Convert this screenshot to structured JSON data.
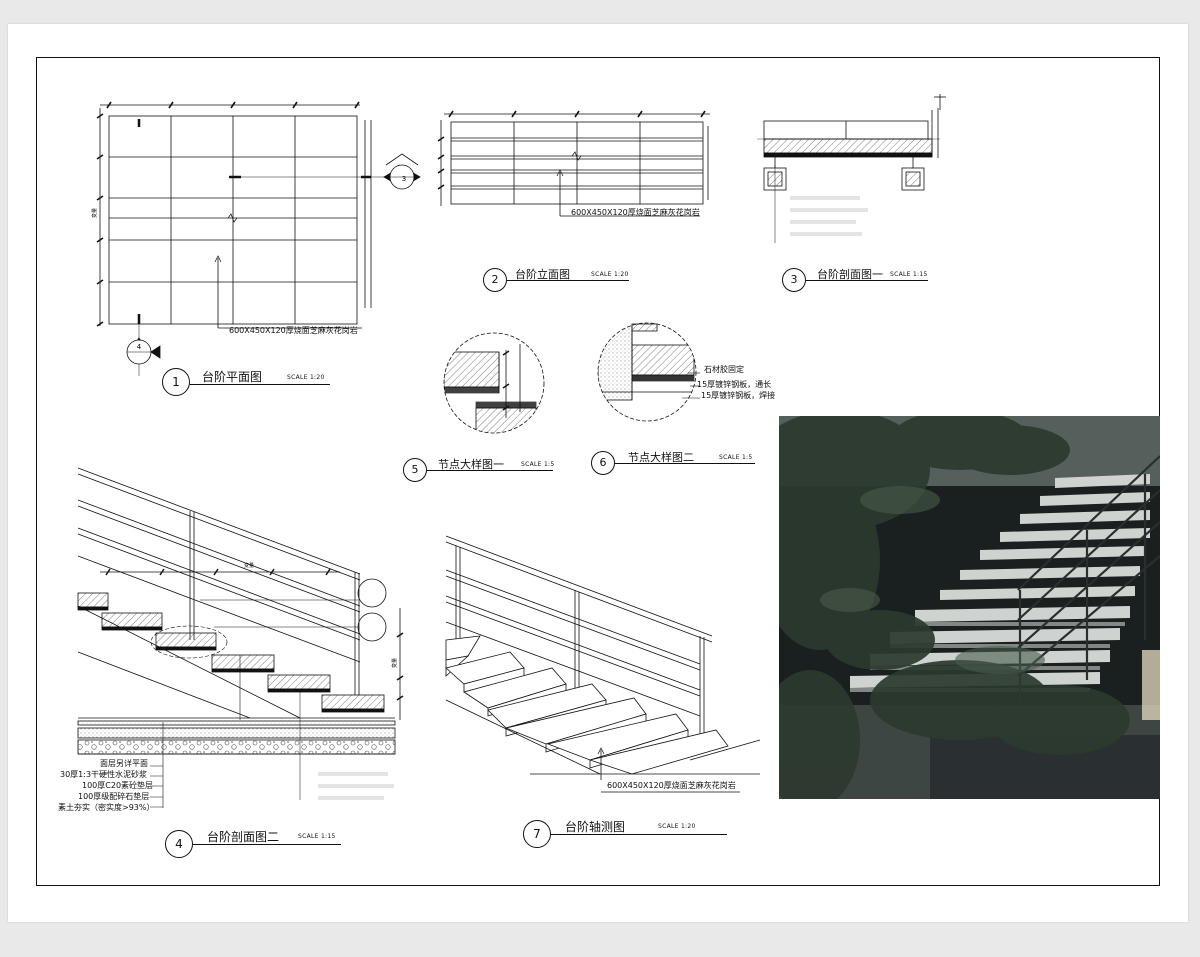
{
  "sheet": {
    "background": "#ffffff",
    "line_color": "#111111"
  },
  "views": [
    {
      "id": "plan",
      "number": "1",
      "title": "台阶平面图",
      "scale": "SCALE 1:20"
    },
    {
      "id": "elevation",
      "number": "2",
      "title": "台阶立面图",
      "scale": "SCALE 1:20"
    },
    {
      "id": "section1",
      "number": "3",
      "title": "台阶剖面图一",
      "scale": "SCALE 1:15"
    },
    {
      "id": "section2",
      "number": "4",
      "title": "台阶剖面图二",
      "scale": "SCALE 1:15"
    },
    {
      "id": "detail1",
      "number": "5",
      "title": "节点大样图一",
      "scale": "SCALE 1:5"
    },
    {
      "id": "detail2",
      "number": "6",
      "title": "节点大样图二",
      "scale": "SCALE 1:5"
    },
    {
      "id": "axonometric",
      "number": "7",
      "title": "台阶轴测图",
      "scale": "SCALE 1:20"
    }
  ],
  "annotations": {
    "granite_spec": "600X450X120厚烧面芝麻灰花岗岩",
    "stone_glue": "石材胶固定",
    "plate_lap": "15厚镀锌钢板，通长",
    "plate_weld": "15厚镀锌钢板，焊接",
    "dim_label": "变量"
  },
  "section_callouts": {
    "plan_right": "3",
    "plan_bottom": "4"
  },
  "layers": [
    "面层另详平面",
    "30厚1:3干硬性水泥砂浆",
    "100厚C20素砼垫层",
    "100厚级配碎石垫层",
    "素土夯实（密实度>93%）"
  ],
  "photo": {
    "subject": "cantilevered granite steps with steel railing behind foliage",
    "palette": [
      "#1e2626",
      "#cfd3d1",
      "#3a4a3e"
    ]
  }
}
